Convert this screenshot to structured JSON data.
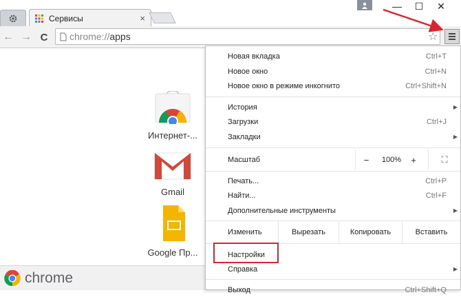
{
  "tab": {
    "title": "Сервисы",
    "close": "×"
  },
  "window": {
    "minimize": "—",
    "maximize": "☐",
    "close": "✕"
  },
  "toolbar": {
    "scheme": "chrome://",
    "path": "apps",
    "back": "←",
    "forward": "→",
    "reload": "C",
    "star": "☆"
  },
  "apps": [
    {
      "label": "Интернет-...",
      "icon": "webstore-icon"
    },
    {
      "label": "Gmail",
      "icon": "gmail-icon"
    },
    {
      "label": "Google Пр...",
      "icon": "slides-icon"
    }
  ],
  "bottom": {
    "brand": "chrome"
  },
  "menu": {
    "items1": [
      {
        "label": "Новая вкладка",
        "shortcut": "Ctrl+T"
      },
      {
        "label": "Новое окно",
        "shortcut": "Ctrl+N"
      },
      {
        "label": "Новое окно в режиме инкогнито",
        "shortcut": "Ctrl+Shift+N"
      }
    ],
    "items2": [
      {
        "label": "История",
        "arrow": "▶"
      },
      {
        "label": "Загрузки",
        "shortcut": "Ctrl+J"
      },
      {
        "label": "Закладки",
        "arrow": "▶"
      }
    ],
    "zoom": {
      "label": "Масштаб",
      "minus": "−",
      "value": "100%",
      "plus": "+",
      "fullscreen": "⛶"
    },
    "items3": [
      {
        "label": "Печать...",
        "shortcut": "Ctrl+P"
      },
      {
        "label": "Найти...",
        "shortcut": "Ctrl+F"
      },
      {
        "label": "Дополнительные инструменты",
        "arrow": "▶"
      }
    ],
    "edit": {
      "label": "Изменить",
      "cut": "Вырезать",
      "copy": "Копировать",
      "paste": "Вставить"
    },
    "items4": [
      {
        "label": "Настройки"
      },
      {
        "label": "Справка",
        "arrow": "▶"
      },
      {
        "label": "Выход",
        "shortcut": "Ctrl+Shift+Q"
      }
    ]
  },
  "colors": {
    "highlight": "#d9262c",
    "accent_arrow": "#d9262c"
  }
}
